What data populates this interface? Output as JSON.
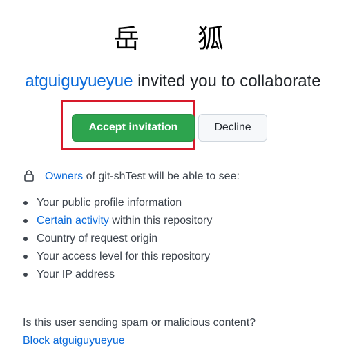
{
  "avatar": {
    "char1": "岳",
    "char2": "狐"
  },
  "invitation": {
    "inviter": "atguiguyueyue",
    "message": " invited you to collaborate"
  },
  "buttons": {
    "accept_label": "Accept invitation",
    "decline_label": "Decline"
  },
  "highlight": {
    "color": "#d7192a"
  },
  "permissions": {
    "owners_link": "Owners",
    "header_suffix": " of git-shTest will be able to see:",
    "items": [
      {
        "text": "Your public profile information"
      },
      {
        "link": "Certain activity",
        "text": " within this repository"
      },
      {
        "text": "Country of request origin"
      },
      {
        "text": "Your access level for this repository"
      },
      {
        "text": "Your IP address"
      }
    ]
  },
  "report": {
    "question": "Is this user sending spam or malicious content?",
    "block_label": "Block atguiguyueyue"
  },
  "colors": {
    "accept_green": "#2da44e",
    "link_blue": "#0969da",
    "decline_bg": "#f6f8fa"
  }
}
